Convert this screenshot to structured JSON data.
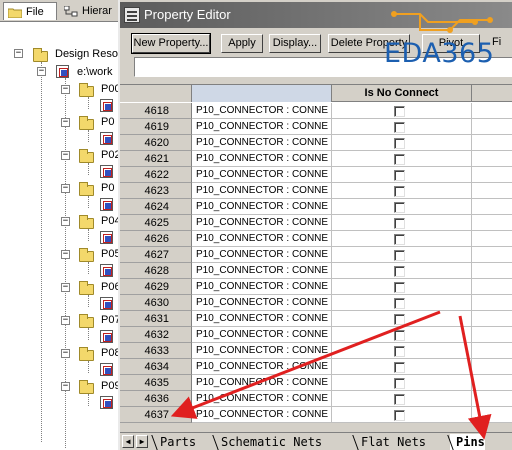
{
  "left_pane": {
    "tabs": [
      {
        "label": "File",
        "icon": "folder-icon"
      },
      {
        "label": "Hierar",
        "icon": "hierarchy-icon"
      }
    ],
    "tree": {
      "root_label": "Design Resou",
      "design_label": "e:\\work",
      "folders": [
        "P00",
        "P0",
        "P02",
        "P0",
        "P04",
        "P05",
        "P06",
        "P07",
        "P08",
        "P09"
      ]
    }
  },
  "window": {
    "title": "Property Editor",
    "toolbar": {
      "new_property": "New Property...",
      "apply": "Apply",
      "display": "Display...",
      "delete_property": "Delete Property",
      "pivot": "Pivot",
      "filter": "Fi"
    },
    "input_value": ""
  },
  "grid": {
    "columns": {
      "row_header": "",
      "name": "",
      "is_no_connect": "Is No Connect"
    },
    "rows": [
      {
        "num": "4618",
        "name": "P10_CONNECTOR : CONNE",
        "no_connect": false
      },
      {
        "num": "4619",
        "name": "P10_CONNECTOR : CONNE",
        "no_connect": false
      },
      {
        "num": "4620",
        "name": "P10_CONNECTOR : CONNE",
        "no_connect": false
      },
      {
        "num": "4621",
        "name": "P10_CONNECTOR : CONNE",
        "no_connect": false
      },
      {
        "num": "4622",
        "name": "P10_CONNECTOR : CONNE",
        "no_connect": false
      },
      {
        "num": "4623",
        "name": "P10_CONNECTOR : CONNE",
        "no_connect": false
      },
      {
        "num": "4624",
        "name": "P10_CONNECTOR : CONNE",
        "no_connect": false
      },
      {
        "num": "4625",
        "name": "P10_CONNECTOR : CONNE",
        "no_connect": false
      },
      {
        "num": "4626",
        "name": "P10_CONNECTOR : CONNE",
        "no_connect": false
      },
      {
        "num": "4627",
        "name": "P10_CONNECTOR : CONNE",
        "no_connect": false
      },
      {
        "num": "4628",
        "name": "P10_CONNECTOR : CONNE",
        "no_connect": false
      },
      {
        "num": "4629",
        "name": "P10_CONNECTOR : CONNE",
        "no_connect": false
      },
      {
        "num": "4630",
        "name": "P10_CONNECTOR : CONNE",
        "no_connect": false
      },
      {
        "num": "4631",
        "name": "P10_CONNECTOR : CONNE",
        "no_connect": false
      },
      {
        "num": "4632",
        "name": "P10_CONNECTOR : CONNE",
        "no_connect": false
      },
      {
        "num": "4633",
        "name": "P10_CONNECTOR : CONNE",
        "no_connect": false
      },
      {
        "num": "4634",
        "name": "P10_CONNECTOR : CONNE",
        "no_connect": false
      },
      {
        "num": "4635",
        "name": "P10_CONNECTOR : CONNE",
        "no_connect": false
      },
      {
        "num": "4636",
        "name": "P10_CONNECTOR : CONNE",
        "no_connect": false
      },
      {
        "num": "4637",
        "name": "P10_CONNECTOR : CONNE",
        "no_connect": false
      }
    ]
  },
  "sheet_tabs": [
    {
      "label": "Parts",
      "active": false
    },
    {
      "label": "Schematic Nets",
      "active": false
    },
    {
      "label": "Flat Nets",
      "active": false
    },
    {
      "label": "Pins",
      "active": true
    }
  ],
  "watermark": {
    "text": "EDA365",
    "color": "#1c5fb0"
  },
  "annotation_color": "#e02020"
}
